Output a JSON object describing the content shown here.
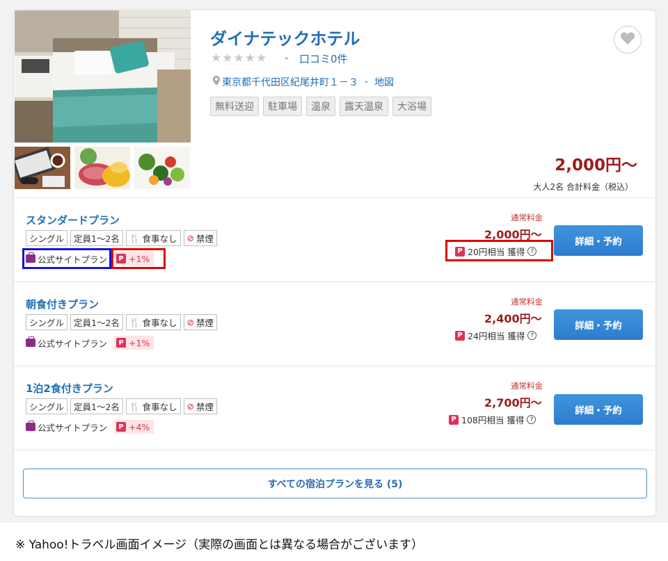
{
  "hotel": {
    "name": "ダイナテックホテル",
    "stars": "★★★★★",
    "dash": "-",
    "review_link": "口コミ0件",
    "address": "東京都千代田区紀尾井町１－３",
    "address_sep": "-",
    "map_link": "地図",
    "tags": [
      "無料送迎",
      "駐車場",
      "温泉",
      "露天温泉",
      "大浴場"
    ],
    "price": "2,000円～",
    "price_note": "大人2名 合計料金（税込）"
  },
  "plans": [
    {
      "title": "スタンダードプラン",
      "chips": [
        "シングル",
        "定員1～2名",
        "食事なし",
        "禁煙"
      ],
      "official": "公式サイトプラン",
      "bonus": "+1%",
      "regular_label": "通常料金",
      "price": "2,000円～",
      "points": "20円相当 獲得",
      "button": "詳細・予約"
    },
    {
      "title": "朝食付きプラン",
      "chips": [
        "シングル",
        "定員1～2名",
        "食事なし",
        "禁煙"
      ],
      "official": "公式サイトプラン",
      "bonus": "+1%",
      "regular_label": "通常料金",
      "price": "2,400円～",
      "points": "24円相当 獲得",
      "button": "詳細・予約"
    },
    {
      "title": "1泊2食付きプラン",
      "chips": [
        "シングル",
        "定員1～2名",
        "食事なし",
        "禁煙"
      ],
      "official": "公式サイトプラン",
      "bonus": "+4%",
      "regular_label": "通常料金",
      "price": "2,700円～",
      "points": "108円相当 獲得",
      "button": "詳細・予約"
    }
  ],
  "all_plans_button": "すべての宿泊プランを見る (5)",
  "caption": "※ Yahoo!トラベル画面イメージ（実際の画面とは異なる場合がございます）",
  "colors": {
    "link_blue": "#1f6fb5",
    "price_red": "#9b1c1c",
    "button_blue": "#2d7ccd",
    "point_pink": "#e0315a",
    "highlight_blue": "#1515d6",
    "highlight_red": "#e00000"
  },
  "icons": [
    "heart-icon",
    "map-pin-icon",
    "fork-knife-icon",
    "no-smoking-icon",
    "bag-icon",
    "paypay-point-icon",
    "help-icon"
  ]
}
